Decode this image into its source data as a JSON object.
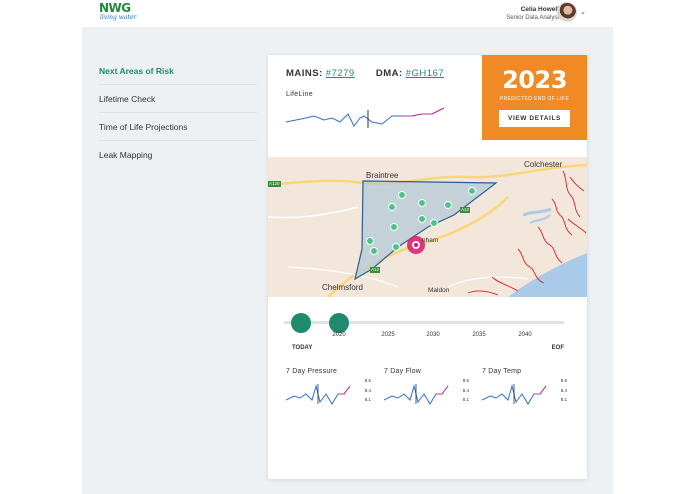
{
  "header": {
    "logo_main": "NWG",
    "logo_tag": "living water",
    "user_name": "Celia Howell",
    "user_role": "Senior Data Analyst"
  },
  "sidebar": {
    "items": [
      {
        "label": "Next Areas of Risk",
        "active": true
      },
      {
        "label": "Lifetime Check",
        "active": false
      },
      {
        "label": "Time of Life Projections",
        "active": false
      },
      {
        "label": "Leak Mapping",
        "active": false
      }
    ]
  },
  "asset": {
    "mains_label": "MAINS:",
    "mains_id": "#7279",
    "dma_label": "DMA:",
    "dma_id": "#GH167",
    "lifeline_label": "LifeLine"
  },
  "prediction": {
    "year": "2023",
    "subtitle": "PREDICTED END OF LIFE",
    "button": "VIEW DETAILS"
  },
  "map": {
    "places": [
      "Braintree",
      "Colchester",
      "Chelmsford",
      "Maldon",
      "nham"
    ],
    "roads": [
      "A120",
      "A12",
      "A12"
    ]
  },
  "timeline": {
    "ticks": [
      "2020",
      "2025",
      "2030",
      "2035",
      "2040"
    ],
    "start_label": "TODAY",
    "end_label": "EOF"
  },
  "metrics": [
    {
      "label": "7 Day Pressure",
      "values": [
        "8.6",
        "8.4",
        "8.1"
      ]
    },
    {
      "label": "7 Day Flow",
      "values": [
        "8.6",
        "8.4",
        "8.1"
      ]
    },
    {
      "label": "7 Day Temp",
      "values": [
        "8.6",
        "8.4",
        "8.1"
      ]
    }
  ],
  "colors": {
    "accent": "#1e8a6e",
    "orange": "#f08a24",
    "spark_blue": "#2f6fd1",
    "spark_pink": "#c2319b"
  }
}
